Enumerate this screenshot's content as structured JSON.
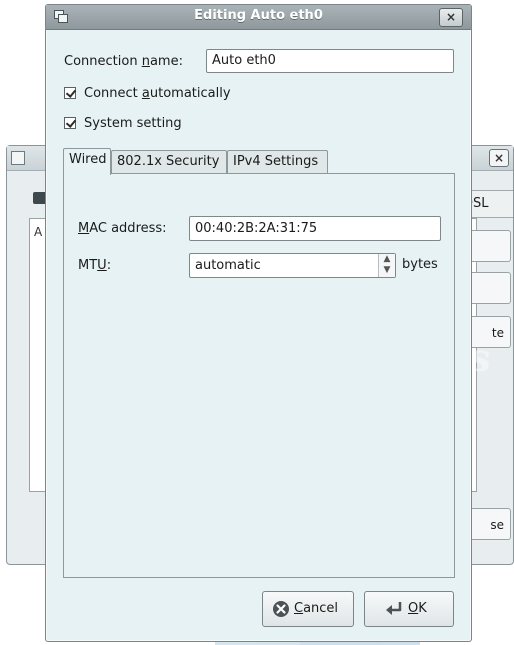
{
  "background_window": {
    "tab_partial_label": "DSL",
    "panel_partial_letter": "A",
    "buttons_partial": [
      "",
      "",
      "te",
      "se"
    ]
  },
  "watermark": {
    "text": "DropBooks"
  },
  "dialog": {
    "title": "Editing Auto eth0",
    "close_glyph": "×",
    "connection_name": {
      "label_pre": "Connection ",
      "label_accel": "n",
      "label_post": "ame:",
      "value": "Auto eth0"
    },
    "connect_automatically": {
      "label_pre": "Connect ",
      "label_accel": "a",
      "label_post": "utomatically",
      "checked": true
    },
    "system_setting": {
      "label": "System setting",
      "checked": true
    },
    "tabs": [
      {
        "label": "Wired",
        "active": true
      },
      {
        "label": "802.1x Security",
        "active": false
      },
      {
        "label": "IPv4 Settings",
        "active": false
      }
    ],
    "wired": {
      "mac_label_accel": "M",
      "mac_label_rest": "AC address:",
      "mac_value": "00:40:2B:2A:31:75",
      "mtu_label_pre": "MT",
      "mtu_label_accel": "U",
      "mtu_label_post": ":",
      "mtu_value": "automatic",
      "mtu_unit": "bytes"
    },
    "buttons": {
      "cancel": {
        "accel": "C",
        "rest": "ancel"
      },
      "ok": {
        "accel": "O",
        "rest": "K"
      }
    }
  }
}
